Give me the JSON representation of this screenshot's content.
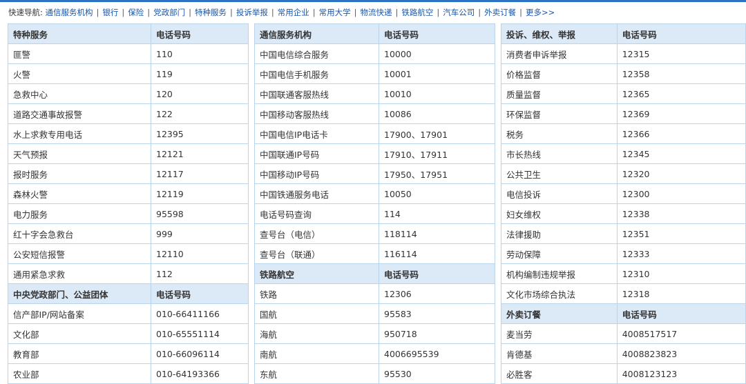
{
  "quicknav": {
    "label": "快速导航:",
    "links": [
      "通信服务机构",
      "银行",
      "保险",
      "党政部门",
      "特种服务",
      "投诉举报",
      "常用企业",
      "常用大学",
      "物流快递",
      "铁路航空",
      "汽车公司",
      "外卖订餐",
      "更多>>"
    ]
  },
  "colors": {
    "header_bg": "#dce9f6",
    "border": "#b9d4ea",
    "link": "#1a56a8"
  },
  "columns": [
    {
      "rows": [
        {
          "head": true,
          "name": "特种服务",
          "phone": "电话号码"
        },
        {
          "name": "匪警",
          "phone": "110"
        },
        {
          "name": "火警",
          "phone": "119"
        },
        {
          "name": "急救中心",
          "phone": "120"
        },
        {
          "name": "道路交通事故报警",
          "phone": "122"
        },
        {
          "name": "水上求救专用电话",
          "phone": "12395"
        },
        {
          "name": "天气预报",
          "phone": "12121"
        },
        {
          "name": "报时服务",
          "phone": "12117"
        },
        {
          "name": "森林火警",
          "phone": "12119"
        },
        {
          "name": "电力服务",
          "phone": "95598"
        },
        {
          "name": "红十字会急救台",
          "phone": "999"
        },
        {
          "name": "公安短信报警",
          "phone": "12110"
        },
        {
          "name": "通用紧急求救",
          "phone": "112"
        },
        {
          "head": true,
          "name": "中央党政部门、公益团体",
          "phone": "电话号码"
        },
        {
          "name": "信产部IP/网站备案",
          "phone": "010-66411166"
        },
        {
          "name": "文化部",
          "phone": "010-65551114"
        },
        {
          "name": "教育部",
          "phone": "010-66096114"
        },
        {
          "name": "农业部",
          "phone": "010-64193366"
        }
      ]
    },
    {
      "rows": [
        {
          "head": true,
          "name": "通信服务机构",
          "phone": "电话号码"
        },
        {
          "name": "中国电信综合服务",
          "phone": "10000"
        },
        {
          "name": "中国电信手机服务",
          "phone": "10001"
        },
        {
          "name": "中国联通客服热线",
          "phone": "10010"
        },
        {
          "name": "中国移动客服热线",
          "phone": "10086"
        },
        {
          "name": "中国电信IP电话卡",
          "phone": "17900、17901"
        },
        {
          "name": "中国联通IP号码",
          "phone": "17910、17911"
        },
        {
          "name": "中国移动IP号码",
          "phone": "17950、17951"
        },
        {
          "name": "中国铁通服务电话",
          "phone": "10050"
        },
        {
          "name": "电话号码查询",
          "phone": "114"
        },
        {
          "name": "查号台（电信）",
          "phone": "118114"
        },
        {
          "name": "查号台（联通）",
          "phone": "116114"
        },
        {
          "head": true,
          "name": "铁路航空",
          "phone": "电话号码"
        },
        {
          "name": "铁路",
          "phone": "12306"
        },
        {
          "name": "国航",
          "phone": "95583"
        },
        {
          "name": "海航",
          "phone": "950718"
        },
        {
          "name": "南航",
          "phone": "4006695539"
        },
        {
          "name": "东航",
          "phone": "95530"
        }
      ]
    },
    {
      "rows": [
        {
          "head": true,
          "name": "投诉、维权、举报",
          "phone": "电话号码"
        },
        {
          "name": "消费者申诉举报",
          "phone": "12315"
        },
        {
          "name": "价格监督",
          "phone": "12358"
        },
        {
          "name": "质量监督",
          "phone": "12365"
        },
        {
          "name": "环保监督",
          "phone": "12369"
        },
        {
          "name": "税务",
          "phone": "12366"
        },
        {
          "name": "市长热线",
          "phone": "12345"
        },
        {
          "name": "公共卫生",
          "phone": "12320"
        },
        {
          "name": "电信投诉",
          "phone": "12300"
        },
        {
          "name": "妇女维权",
          "phone": "12338"
        },
        {
          "name": "法律援助",
          "phone": "12351"
        },
        {
          "name": "劳动保障",
          "phone": "12333"
        },
        {
          "name": "机构编制违规举报",
          "phone": "12310"
        },
        {
          "name": "文化市场综合执法",
          "phone": "12318"
        },
        {
          "head": true,
          "name": "外卖订餐",
          "phone": "电话号码"
        },
        {
          "name": "麦当劳",
          "phone": "4008517517"
        },
        {
          "name": "肯德基",
          "phone": "4008823823"
        },
        {
          "name": "必胜客",
          "phone": "4008123123"
        }
      ]
    }
  ]
}
